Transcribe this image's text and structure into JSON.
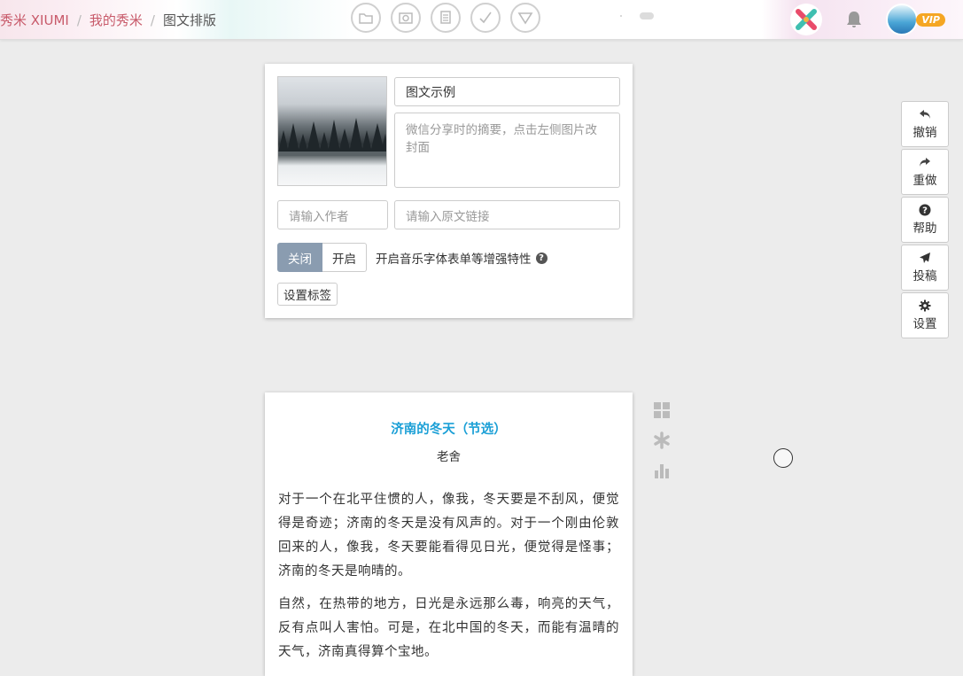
{
  "breadcrumb": {
    "home": "秀米 XIUMI",
    "mine": "我的秀米",
    "current": "图文排版",
    "separator": "/"
  },
  "toolbar": {
    "icons": [
      "folder-icon",
      "preview-icon",
      "copy-icon",
      "check-icon",
      "download-icon"
    ]
  },
  "user": {
    "vip": "VIP"
  },
  "settings": {
    "title_value": "图文示例",
    "summary_placeholder": "微信分享时的摘要，点击左侧图片改封面",
    "author_placeholder": "请输入作者",
    "link_placeholder": "请输入原文链接",
    "toggle_off": "关闭",
    "toggle_on": "开启",
    "toggle_state": "关闭",
    "enhance_label": "开启音乐字体表单等增强特性",
    "tag_button": "设置标签"
  },
  "article": {
    "title": "济南的冬天（节选）",
    "author": "老舍",
    "paragraphs": [
      "对于一个在北平住惯的人，像我，冬天要是不刮风，便觉得是奇迹；济南的冬天是没有风声的。对于一个刚由伦敦回来的人，像我，冬天要能看得见日光，便觉得是怪事；济南的冬天是响晴的。",
      "自然，在热带的地方，日光是永远那么毒，响亮的天气，反有点叫人害怕。可是，在北中国的冬天，而能有温晴的天气，济南真得算个宝地。"
    ]
  },
  "right_panel": {
    "undo": "撤销",
    "redo": "重做",
    "help": "帮助",
    "submit": "投稿",
    "settings": "设置"
  },
  "colors": {
    "breadcrumb_link": "#c85a6a",
    "article_title": "#1a9fd6",
    "toggle_off_bg": "#8a9cb0",
    "vip": "#f5a623"
  }
}
